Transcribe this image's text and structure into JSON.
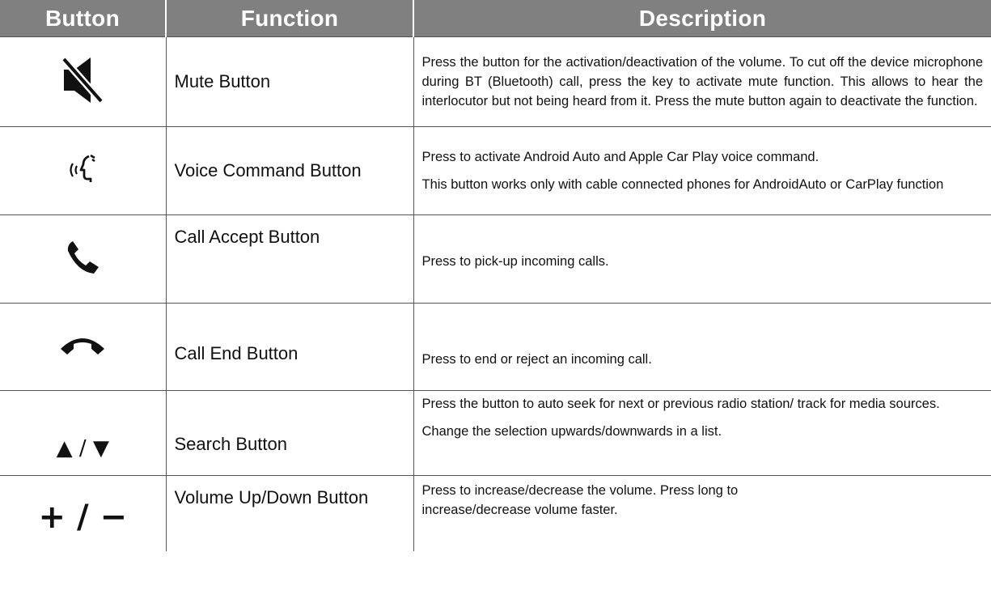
{
  "headers": {
    "button": "Button",
    "function": "Function",
    "description": "Description"
  },
  "rows": [
    {
      "icon": "mute-icon",
      "function": "Mute Button",
      "description": [
        "Press the button for the activation/deactivation of the volume. To cut off the  device microphone during BT (Bluetooth) call, press the  key to activate mute function. This allows to hear the interlocutor but not being heard from it. Press the mute button again to deactivate the function."
      ]
    },
    {
      "icon": "voice-command-icon",
      "function": "Voice Command Button",
      "description": [
        "Press to activate Android Auto and Apple Car Play voice command.",
        "This button works only with cable connected phones for AndroidAuto or CarPlay function"
      ]
    },
    {
      "icon": "call-accept-icon",
      "function": "Call Accept Button",
      "description": [
        "Press to pick-up incoming calls."
      ]
    },
    {
      "icon": "call-end-icon",
      "function": "Call End Button",
      "description": [
        "Press to end or reject an incoming call."
      ]
    },
    {
      "icon": "up-down-arrows-icon",
      "icon_text": "▲ / ▼",
      "function": "Search Button",
      "description": [
        "Press the button to auto seek for next or previous radio station/ track for media sources.",
        "Change the selection upwards/downwards in a list."
      ]
    },
    {
      "icon": "plus-minus-icon",
      "icon_text": "+ / −",
      "function": "Volume Up/Down Button",
      "description": [
        "Press to increase/decrease the volume. Press long to increase/decrease volume faster."
      ]
    }
  ],
  "colors": {
    "header_bg": "#808080",
    "header_text": "#ffffff",
    "border": "#555555"
  }
}
